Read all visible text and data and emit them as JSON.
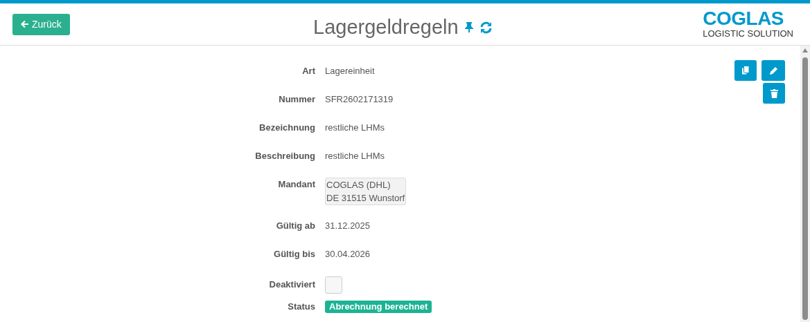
{
  "back_button": {
    "label": "Zurück"
  },
  "title": "Lagergeldregeln",
  "logo": {
    "name": "COGLAS",
    "tagline": "LOGISTIC SOLUTION"
  },
  "fields": [
    {
      "kind": "text",
      "label": "Art",
      "value": "Lagereinheit"
    },
    {
      "kind": "text",
      "label": "Nummer",
      "value": "SFR2602171319"
    },
    {
      "kind": "text",
      "label": "Bezeichnung",
      "value": "restliche LHMs"
    },
    {
      "kind": "text",
      "label": "Beschreibung",
      "value": "restliche LHMs"
    },
    {
      "kind": "box",
      "label": "Mandant",
      "lines": [
        "COGLAS (DHL)",
        "DE 31515 Wunstorf"
      ]
    },
    {
      "kind": "text",
      "label": "Gültig ab",
      "value": "31.12.2025"
    },
    {
      "kind": "text",
      "label": "Gültig bis",
      "value": "30.04.2026"
    },
    {
      "kind": "checkbox",
      "label": "Deaktiviert",
      "checked": false
    },
    {
      "kind": "badge",
      "label": "Status",
      "value": "Abrechnung berechnet"
    }
  ]
}
